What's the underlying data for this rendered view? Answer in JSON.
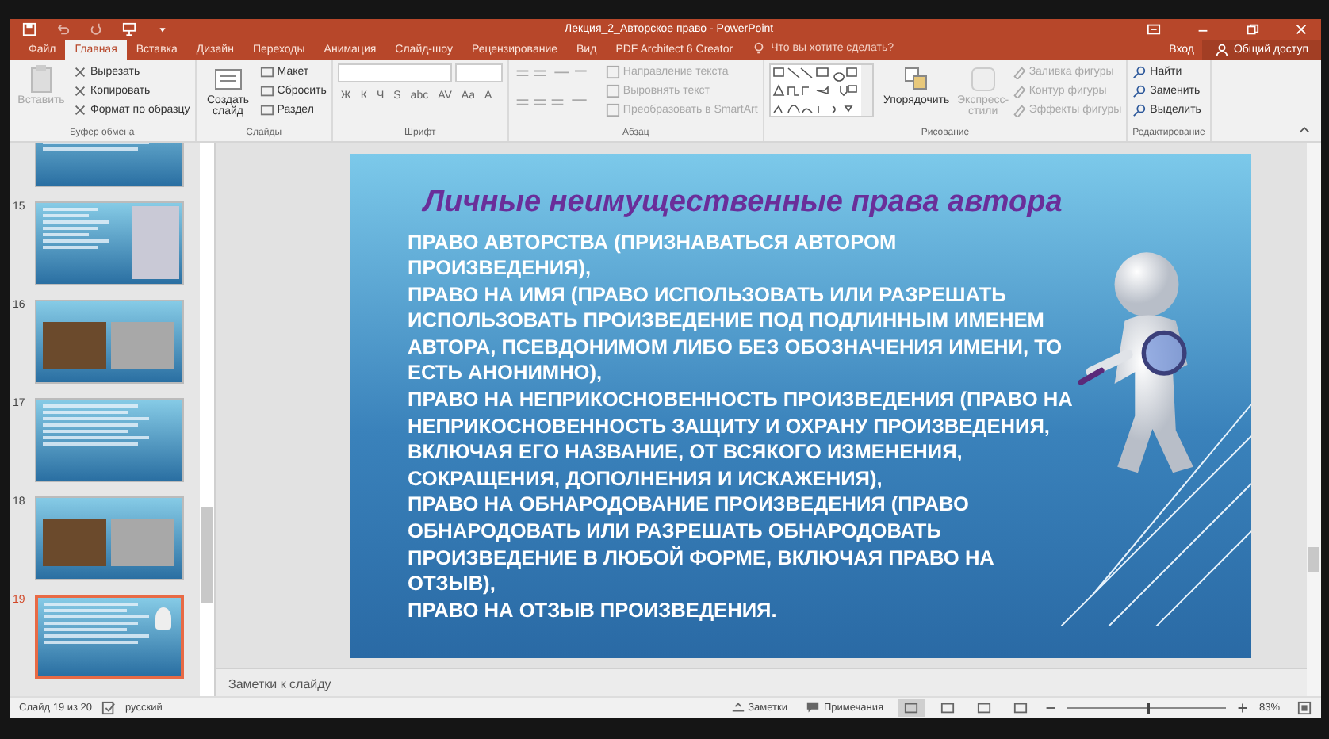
{
  "window": {
    "title": "Лекция_2_Авторское право - PowerPoint"
  },
  "tabs": [
    {
      "label": "Файл",
      "selected": false
    },
    {
      "label": "Главная",
      "selected": true
    },
    {
      "label": "Вставка",
      "selected": false
    },
    {
      "label": "Дизайн",
      "selected": false
    },
    {
      "label": "Переходы",
      "selected": false
    },
    {
      "label": "Анимация",
      "selected": false
    },
    {
      "label": "Слайд-шоу",
      "selected": false
    },
    {
      "label": "Рецензирование",
      "selected": false
    },
    {
      "label": "Вид",
      "selected": false
    },
    {
      "label": "PDF Architect 6 Creator",
      "selected": false
    }
  ],
  "tell_me": {
    "placeholder": "Что вы хотите сделать?"
  },
  "account": {
    "sign_in": "Вход",
    "share": "Общий доступ"
  },
  "clipboard": {
    "label": "Буфер обмена",
    "paste": "Вставить",
    "items": [
      "Вырезать",
      "Копировать",
      "Формат по образцу"
    ]
  },
  "slides_group": {
    "label": "Слайды",
    "new_slide": "Создать слайд",
    "items": [
      "Макет",
      "Сбросить",
      "Раздел"
    ]
  },
  "font": {
    "label": "Шрифт",
    "buttons": [
      "Ж",
      "К",
      "Ч",
      "S",
      "abc",
      "AV",
      "Aa",
      "A"
    ]
  },
  "paragraph": {
    "label": "Абзац",
    "items": [
      {
        "label": "Направление текста",
        "disabled": true
      },
      {
        "label": "Выровнять текст",
        "disabled": true
      },
      {
        "label": "Преобразовать в SmartArt",
        "disabled": true
      }
    ]
  },
  "drawing": {
    "label": "Рисование",
    "arrange": "Упорядочить",
    "quick_styles": "Экспресс-стили",
    "items": [
      {
        "label": "Заливка фигуры",
        "disabled": true
      },
      {
        "label": "Контур фигуры",
        "disabled": true
      },
      {
        "label": "Эффекты фигуры",
        "disabled": true
      }
    ]
  },
  "editing": {
    "label": "Редактирование",
    "items": [
      "Найти",
      "Заменить",
      "Выделить"
    ]
  },
  "thumbnails": [
    {
      "kind": "text",
      "selected": false
    },
    {
      "number": "15",
      "kind": "mixed",
      "selected": false
    },
    {
      "number": "16",
      "kind": "photos",
      "selected": false
    },
    {
      "number": "17",
      "kind": "text",
      "selected": false
    },
    {
      "number": "18",
      "kind": "photos",
      "selected": false
    },
    {
      "number": "19",
      "kind": "figure",
      "selected": true
    }
  ],
  "slide": {
    "title": "Личные неимущественные права автора",
    "paragraphs": [
      "ПРАВО АВТОРСТВА (ПРИЗНАВАТЬСЯ АВТОРОМ ПРОИЗВЕДЕНИЯ),",
      "ПРАВО НА ИМЯ (ПРАВО ИСПОЛЬЗОВАТЬ ИЛИ РАЗРЕШАТЬ ИСПОЛЬЗОВАТЬ ПРОИЗВЕДЕНИЕ ПОД ПОДЛИННЫМ ИМЕНЕМ АВТОРА, ПСЕВДОНИМОМ ЛИБО БЕЗ ОБОЗНАЧЕНИЯ ИМЕНИ, ТО ЕСТЬ АНОНИМНО),",
      "ПРАВО НА НЕПРИКОСНОВЕННОСТЬ ПРОИЗВЕДЕНИЯ (ПРАВО НА НЕПРИКОСНОВЕННОСТЬ ЗАЩИТУ И ОХРАНУ ПРОИЗВЕДЕНИЯ, ВКЛЮЧАЯ ЕГО НАЗВАНИЕ, ОТ ВСЯКОГО ИЗМЕНЕНИЯ, СОКРАЩЕНИЯ, ДОПОЛНЕНИЯ И ИСКАЖЕНИЯ),",
      "ПРАВО НА ОБНАРОДОВАНИЕ ПРОИЗВЕДЕНИЯ (ПРАВО ОБНАРОДОВАТЬ ИЛИ РАЗРЕШАТЬ ОБНАРОДОВАТЬ ПРОИЗВЕДЕНИЕ В ЛЮБОЙ ФОРМЕ, ВКЛЮЧАЯ ПРАВО НА ОТЗЫВ),",
      "ПРАВО НА ОТЗЫВ ПРОИЗВЕДЕНИЯ."
    ]
  },
  "notes": {
    "placeholder": "Заметки к слайду"
  },
  "status_bar": {
    "slide_counter": "Слайд 19 из 20",
    "language": "русский",
    "notes": "Заметки",
    "comments": "Примечания",
    "views": [
      {
        "selected": true
      },
      {
        "selected": false
      },
      {
        "selected": false
      },
      {
        "selected": false
      }
    ],
    "zoom": {
      "level": 0.5,
      "label": "83%"
    }
  }
}
